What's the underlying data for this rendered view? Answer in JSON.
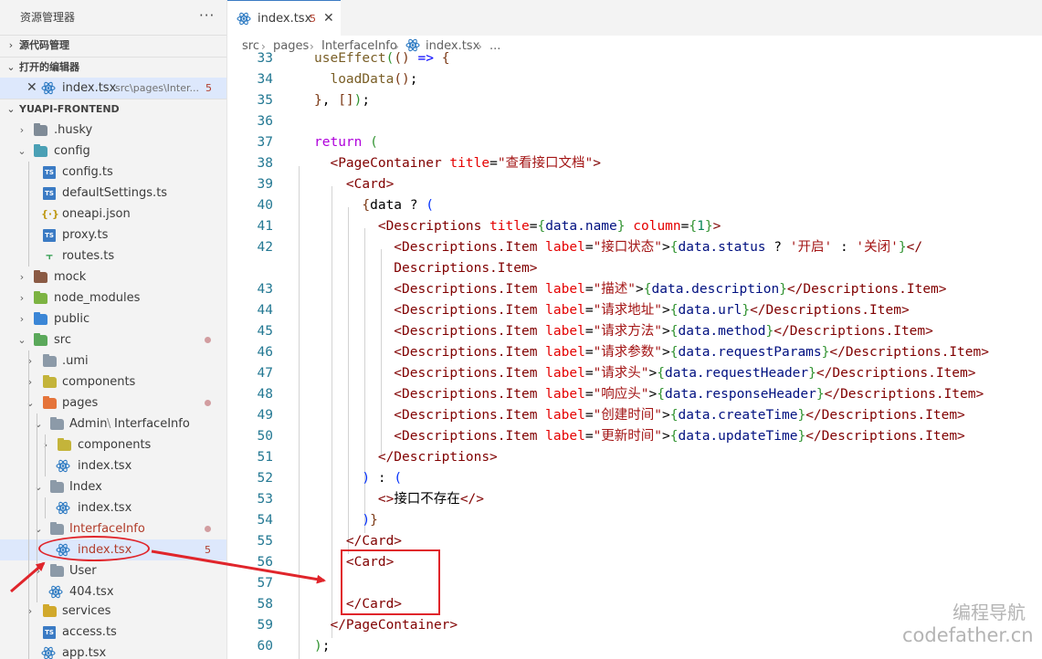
{
  "sidebar": {
    "title": "资源管理器",
    "more": "···",
    "scm_label": "源代码管理",
    "open_editors_label": "打开的编辑器",
    "open_editor": {
      "close": "✕",
      "name": "index.tsx",
      "path": "src\\pages\\Inter...",
      "badge": "5"
    },
    "project_label": "YUAPI-FRONTEND",
    "tree": [
      {
        "label": ".husky"
      },
      {
        "label": "config"
      },
      {
        "label": "config.ts"
      },
      {
        "label": "defaultSettings.ts"
      },
      {
        "label": "oneapi.json"
      },
      {
        "label": "proxy.ts"
      },
      {
        "label": "routes.ts"
      },
      {
        "label": "mock"
      },
      {
        "label": "node_modules"
      },
      {
        "label": "public"
      },
      {
        "label": "src"
      },
      {
        "label": ".umi"
      },
      {
        "label": "components"
      },
      {
        "label": "pages"
      },
      {
        "label": "Admin",
        "sep": "\\",
        "label2": "InterfaceInfo"
      },
      {
        "label": "components"
      },
      {
        "label": "index.tsx"
      },
      {
        "label": "Index"
      },
      {
        "label": "index.tsx"
      },
      {
        "label": "InterfaceInfo"
      },
      {
        "label": "index.tsx",
        "badge": "5"
      },
      {
        "label": "User"
      },
      {
        "label": "404.tsx"
      },
      {
        "label": "services"
      },
      {
        "label": "access.ts"
      },
      {
        "label": "app.tsx"
      }
    ]
  },
  "tab": {
    "label": "index.tsx",
    "badge": "5",
    "close": "✕"
  },
  "breadcrumb": {
    "items": [
      "src",
      "pages",
      "InterfaceInfo",
      "index.tsx",
      "..."
    ],
    "sep": "›"
  },
  "editor": {
    "line_numbers": [
      "33",
      "34",
      "35",
      "36",
      "37",
      "38",
      "39",
      "40",
      "41",
      "42",
      "43",
      "44",
      "45",
      "46",
      "47",
      "48",
      "49",
      "50",
      "51",
      "52",
      "53",
      "54",
      "55",
      "56",
      "57",
      "58",
      "59",
      "60"
    ],
    "lines": [
      [
        [
          "useEffect",
          "c-fn"
        ],
        [
          "(",
          "c-br1"
        ],
        [
          "() ",
          "c-br2"
        ],
        [
          "=> ",
          "c-kw"
        ],
        [
          "{",
          "c-br2"
        ]
      ],
      [
        [
          "  loadData",
          "c-fn"
        ],
        [
          "()",
          "c-br2"
        ],
        [
          ";",
          ""
        ]
      ],
      [
        [
          "}",
          "c-br2"
        ],
        [
          ", ",
          ""
        ],
        [
          "[]",
          "c-br2"
        ],
        [
          ")",
          "c-br1"
        ],
        [
          ";",
          ""
        ]
      ],
      [],
      [
        [
          "return ",
          "c-kw2"
        ],
        [
          "(",
          "c-br1"
        ]
      ],
      [
        [
          "  <",
          "c-tag"
        ],
        [
          "PageContainer ",
          "c-tag"
        ],
        [
          "title",
          "c-attr"
        ],
        [
          "=",
          ""
        ],
        [
          "\"查看接口文档\"",
          "c-str"
        ],
        [
          ">",
          "c-tag"
        ]
      ],
      [
        [
          "    <",
          "c-tag"
        ],
        [
          "Card",
          "c-tag"
        ],
        [
          ">",
          "c-tag"
        ]
      ],
      [
        [
          "      {",
          "c-br2"
        ],
        [
          "data ",
          ""
        ],
        [
          "? ",
          ""
        ],
        [
          "(",
          "c-br3"
        ]
      ],
      [
        [
          "        <",
          "c-tag"
        ],
        [
          "Descriptions ",
          "c-tag"
        ],
        [
          "title",
          "c-attr"
        ],
        [
          "=",
          ""
        ],
        [
          "{",
          "c-br1"
        ],
        [
          "data.name",
          "c-var"
        ],
        [
          "} ",
          "c-br1"
        ],
        [
          "column",
          "c-attr"
        ],
        [
          "=",
          ""
        ],
        [
          "{",
          "c-br1"
        ],
        [
          "1",
          "c-num"
        ],
        [
          "}",
          "c-br1"
        ],
        [
          ">",
          "c-tag"
        ]
      ],
      [
        [
          "          <",
          "c-tag"
        ],
        [
          "Descriptions.Item ",
          "c-tag"
        ],
        [
          "label",
          "c-attr"
        ],
        [
          "=",
          ""
        ],
        [
          "\"接口状态\"",
          "c-str"
        ],
        [
          ">",
          ""
        ],
        [
          "{",
          "c-br1"
        ],
        [
          "data.status ",
          "c-var"
        ],
        [
          "? ",
          ""
        ],
        [
          "'开启' ",
          "c-str"
        ],
        [
          ": ",
          ""
        ],
        [
          "'关闭'",
          "c-str"
        ],
        [
          "}",
          "c-br1"
        ],
        [
          "</",
          "c-tag"
        ]
      ],
      [
        [
          "          Descriptions.Item",
          "c-tag"
        ],
        [
          ">",
          "c-tag"
        ]
      ],
      [
        [
          "          <",
          "c-tag"
        ],
        [
          "Descriptions.Item ",
          "c-tag"
        ],
        [
          "label",
          "c-attr"
        ],
        [
          "=",
          ""
        ],
        [
          "\"描述\"",
          "c-str"
        ],
        [
          ">",
          ""
        ],
        [
          "{",
          "c-br1"
        ],
        [
          "data.description",
          "c-var"
        ],
        [
          "}",
          "c-br1"
        ],
        [
          "</Descriptions.Item>",
          "c-tag"
        ]
      ],
      [
        [
          "          <",
          "c-tag"
        ],
        [
          "Descriptions.Item ",
          "c-tag"
        ],
        [
          "label",
          "c-attr"
        ],
        [
          "=",
          ""
        ],
        [
          "\"请求地址\"",
          "c-str"
        ],
        [
          ">",
          ""
        ],
        [
          "{",
          "c-br1"
        ],
        [
          "data.url",
          "c-var"
        ],
        [
          "}",
          "c-br1"
        ],
        [
          "</Descriptions.Item>",
          "c-tag"
        ]
      ],
      [
        [
          "          <",
          "c-tag"
        ],
        [
          "Descriptions.Item ",
          "c-tag"
        ],
        [
          "label",
          "c-attr"
        ],
        [
          "=",
          ""
        ],
        [
          "\"请求方法\"",
          "c-str"
        ],
        [
          ">",
          ""
        ],
        [
          "{",
          "c-br1"
        ],
        [
          "data.method",
          "c-var"
        ],
        [
          "}",
          "c-br1"
        ],
        [
          "</Descriptions.Item>",
          "c-tag"
        ]
      ],
      [
        [
          "          <",
          "c-tag"
        ],
        [
          "Descriptions.Item ",
          "c-tag"
        ],
        [
          "label",
          "c-attr"
        ],
        [
          "=",
          ""
        ],
        [
          "\"请求参数\"",
          "c-str"
        ],
        [
          ">",
          ""
        ],
        [
          "{",
          "c-br1"
        ],
        [
          "data.requestParams",
          "c-var"
        ],
        [
          "}",
          "c-br1"
        ],
        [
          "</Descriptions.Item>",
          "c-tag"
        ]
      ],
      [
        [
          "          <",
          "c-tag"
        ],
        [
          "Descriptions.Item ",
          "c-tag"
        ],
        [
          "label",
          "c-attr"
        ],
        [
          "=",
          ""
        ],
        [
          "\"请求头\"",
          "c-str"
        ],
        [
          ">",
          ""
        ],
        [
          "{",
          "c-br1"
        ],
        [
          "data.requestHeader",
          "c-var"
        ],
        [
          "}",
          "c-br1"
        ],
        [
          "</Descriptions.Item>",
          "c-tag"
        ]
      ],
      [
        [
          "          <",
          "c-tag"
        ],
        [
          "Descriptions.Item ",
          "c-tag"
        ],
        [
          "label",
          "c-attr"
        ],
        [
          "=",
          ""
        ],
        [
          "\"响应头\"",
          "c-str"
        ],
        [
          ">",
          ""
        ],
        [
          "{",
          "c-br1"
        ],
        [
          "data.responseHeader",
          "c-var"
        ],
        [
          "}",
          "c-br1"
        ],
        [
          "</Descriptions.Item>",
          "c-tag"
        ]
      ],
      [
        [
          "          <",
          "c-tag"
        ],
        [
          "Descriptions.Item ",
          "c-tag"
        ],
        [
          "label",
          "c-attr"
        ],
        [
          "=",
          ""
        ],
        [
          "\"创建时间\"",
          "c-str"
        ],
        [
          ">",
          ""
        ],
        [
          "{",
          "c-br1"
        ],
        [
          "data.createTime",
          "c-var"
        ],
        [
          "}",
          "c-br1"
        ],
        [
          "</Descriptions.Item>",
          "c-tag"
        ]
      ],
      [
        [
          "          <",
          "c-tag"
        ],
        [
          "Descriptions.Item ",
          "c-tag"
        ],
        [
          "label",
          "c-attr"
        ],
        [
          "=",
          ""
        ],
        [
          "\"更新时间\"",
          "c-str"
        ],
        [
          ">",
          ""
        ],
        [
          "{",
          "c-br1"
        ],
        [
          "data.updateTime",
          "c-var"
        ],
        [
          "}",
          "c-br1"
        ],
        [
          "</Descriptions.Item>",
          "c-tag"
        ]
      ],
      [
        [
          "        </Descriptions>",
          "c-tag"
        ]
      ],
      [
        [
          "      ) ",
          "c-br3"
        ],
        [
          ": ",
          ""
        ],
        [
          "(",
          "c-br3"
        ]
      ],
      [
        [
          "        <>",
          "c-tag"
        ],
        [
          "接口不存在",
          ""
        ],
        [
          "</>",
          "c-tag"
        ]
      ],
      [
        [
          "      )",
          "c-br3"
        ],
        [
          "}",
          "c-br2"
        ]
      ],
      [
        [
          "    </Card>",
          "c-tag"
        ]
      ],
      [
        [
          "    <Card>",
          "c-tag"
        ]
      ],
      [],
      [
        [
          "    </Card>",
          "c-tag"
        ]
      ],
      [
        [
          "  </PageContainer>",
          "c-tag"
        ]
      ],
      [
        [
          ")",
          "c-br1"
        ],
        [
          ";",
          ""
        ]
      ]
    ]
  },
  "watermark": {
    "line1": "编程导航",
    "line2": "codefather.cn"
  }
}
